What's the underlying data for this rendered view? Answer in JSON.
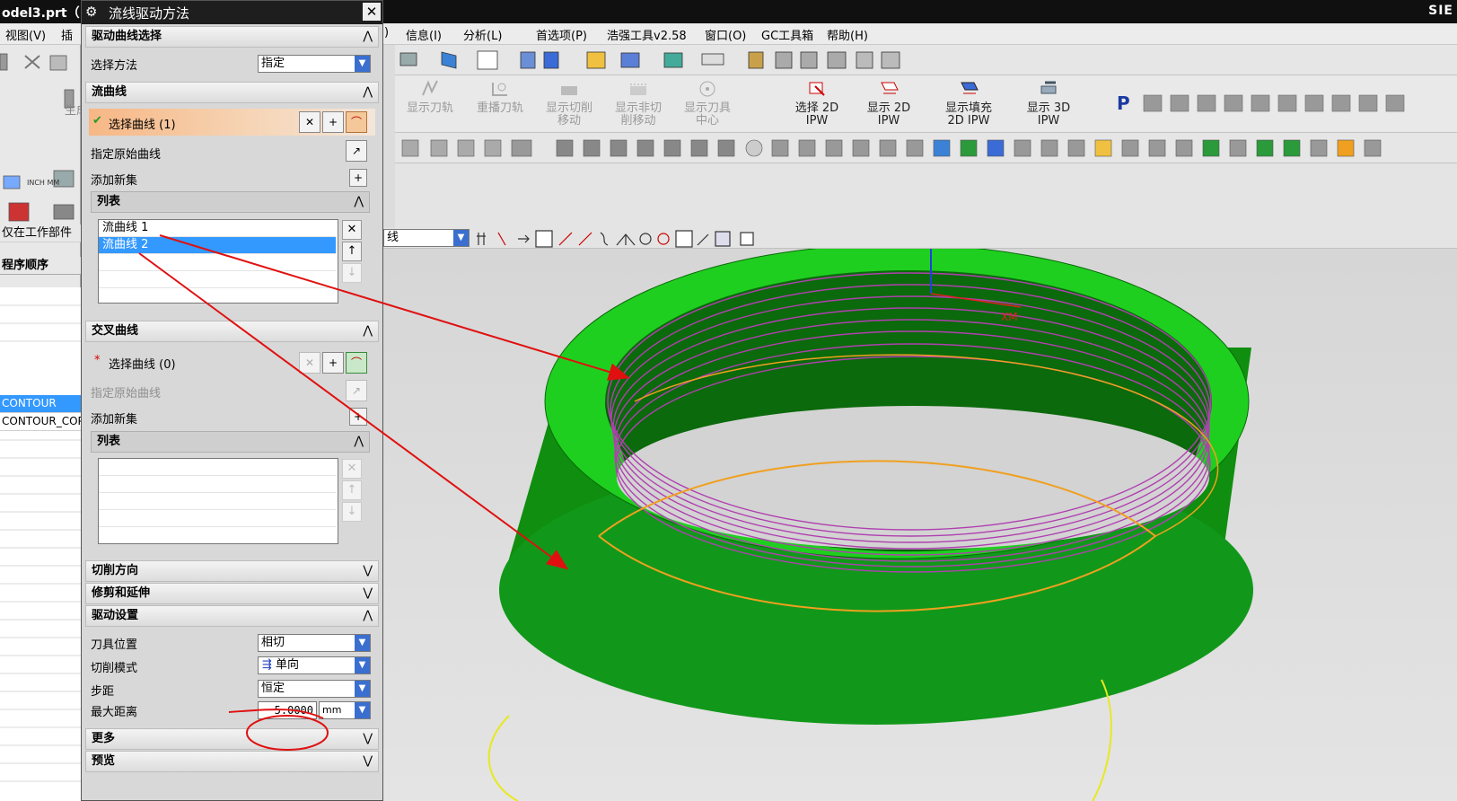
{
  "window": {
    "title": "odel3.prt（",
    "brand": "SIE"
  },
  "menu": {
    "left_items": [
      "视图(V)",
      "插"
    ],
    "right_items": [
      ")",
      "信息(I)",
      "分析(L)",
      "首选项(P)",
      "浩强工具v2.58",
      "窗口(O)",
      "GC工具箱",
      "帮助(H)"
    ]
  },
  "toolbar": {
    "left_big_label": "生成",
    "op_buttons": [
      {
        "label1": "显示刀轨",
        "label2": ""
      },
      {
        "label1": "重播刀轨",
        "label2": ""
      },
      {
        "label1": "显示切削",
        "label2": "移动"
      },
      {
        "label1": "显示非切",
        "label2": "削移动"
      },
      {
        "label1": "显示刀具",
        "label2": "中心"
      }
    ],
    "ipw_buttons": [
      {
        "label1": "选择 2D",
        "label2": "IPW"
      },
      {
        "label1": "显示 2D",
        "label2": "IPW"
      },
      {
        "label1": "显示填充",
        "label2": "2D IPW"
      },
      {
        "label1": "显示 3D",
        "label2": "IPW"
      }
    ],
    "units_icon_text": "INCH MM"
  },
  "navigator": {
    "filter_label": "仅在工作部件",
    "order_label": "程序顺序",
    "rows": [
      "CONTOUR",
      "CONTOUR_COP"
    ]
  },
  "selection_bar": {
    "filter_value": "线"
  },
  "dialog": {
    "title": "流线驱动方法",
    "close_label": "✕",
    "drive_curve_section": "驱动曲线选择",
    "select_method_label": "选择方法",
    "select_method_value": "指定",
    "flow_section": "流曲线",
    "flow_select_label": "选择曲线 (1)",
    "flow_specify_label": "指定原始曲线",
    "flow_add_set_label": "添加新集",
    "flow_list_header": "列表",
    "flow_list_items": [
      "流曲线 1",
      "流曲线 2"
    ],
    "cross_section": "交叉曲线",
    "cross_select_label": "选择曲线 (0)",
    "cross_specify_label": "指定原始曲线",
    "cross_add_set_label": "添加新集",
    "cross_list_header": "列表",
    "cut_direction_section": "切削方向",
    "trim_extend_section": "修剪和延伸",
    "drive_settings_section": "驱动设置",
    "tool_position_label": "刀具位置",
    "tool_position_value": "相切",
    "cut_mode_label": "切削模式",
    "cut_mode_value": "单向",
    "stepover_label": "步距",
    "stepover_value": "恒定",
    "max_distance_label": "最大距离",
    "max_distance_value": "5.0000",
    "max_distance_unit": "mm",
    "more_section": "更多",
    "preview_section": "预览"
  },
  "viewport": {
    "axis_label": "XM",
    "part_color": "#1fcf1f",
    "part_dark_color": "#0d7d0d",
    "thread_color": "#b040b0",
    "curve_color": "#f0a020",
    "annotation_color": "#e01010"
  }
}
